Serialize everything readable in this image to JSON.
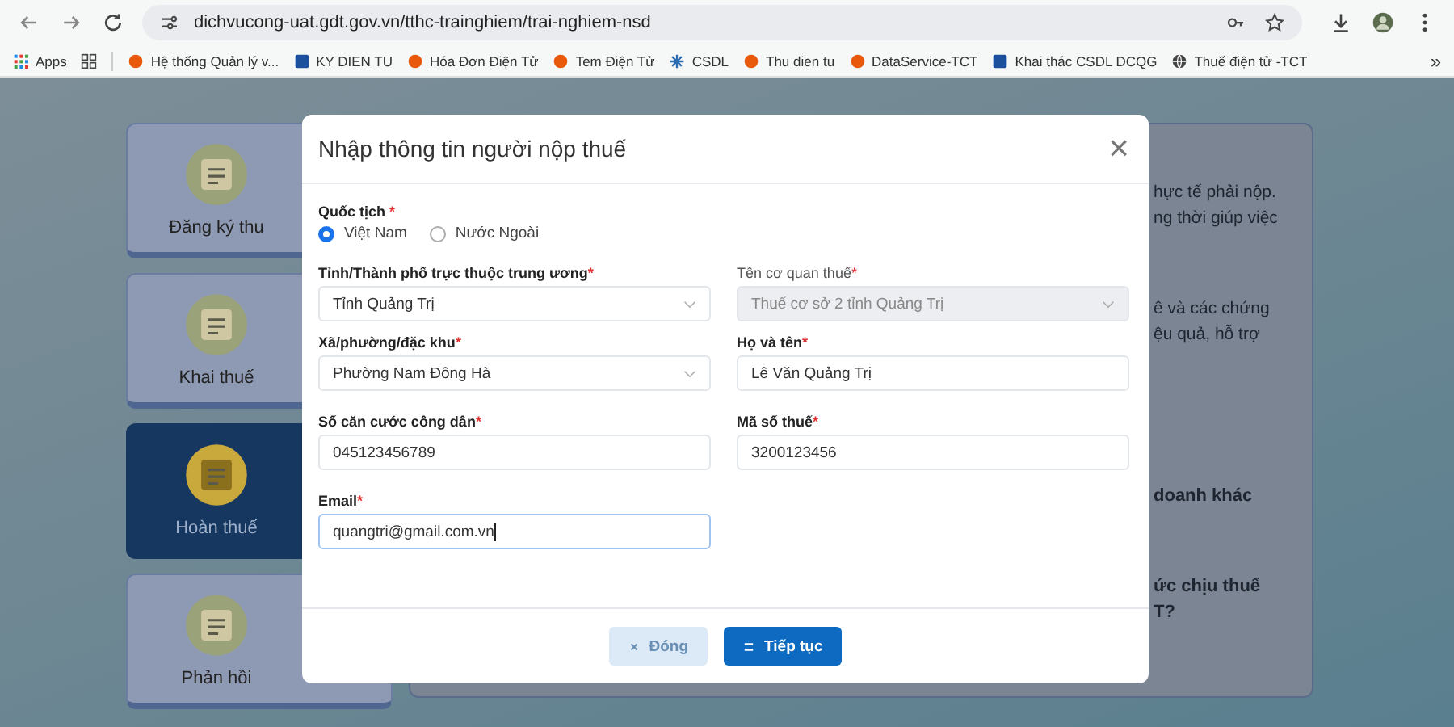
{
  "browser": {
    "url": "dichvucong-uat.gdt.gov.vn/tthc-trainghiem/trai-nghiem-nsd",
    "bookmarks": [
      {
        "label": "Apps",
        "kind": "apps"
      },
      {
        "label": "Hệ thống Quản lý v...",
        "kind": "dot",
        "color": "#e8590c"
      },
      {
        "label": "KY DIEN TU",
        "kind": "square",
        "color": "#1c4f9c"
      },
      {
        "label": "Hóa Đơn Điện Tử",
        "kind": "dot",
        "color": "#e8590c"
      },
      {
        "label": "Tem Điện Tử",
        "kind": "dot",
        "color": "#e8590c"
      },
      {
        "label": "CSDL",
        "kind": "star",
        "color": "#2b6cb0"
      },
      {
        "label": "Thu dien tu",
        "kind": "dot",
        "color": "#e8590c"
      },
      {
        "label": "DataService-TCT",
        "kind": "dot",
        "color": "#e8590c"
      },
      {
        "label": "Khai thác CSDL DCQG",
        "kind": "square",
        "color": "#1c4f9c"
      },
      {
        "label": "Thuế điện tử -TCT",
        "kind": "globe",
        "color": "#444444"
      }
    ],
    "more": "»"
  },
  "services": [
    {
      "label": "Đăng ký thu",
      "selected": false
    },
    {
      "label": "Khai thuế",
      "selected": false
    },
    {
      "label": "Hoàn thuế",
      "selected": true
    },
    {
      "label": "Phản hồi",
      "selected": false
    }
  ],
  "info_panel": {
    "lines": [
      {
        "text": "hực tế phải nộp.",
        "bold": false
      },
      {
        "text": "ng thời giúp việc",
        "bold": false
      },
      {
        "text": "ê và các chứng",
        "bold": false
      },
      {
        "text": "ệu quả, hỗ trợ",
        "bold": false
      },
      {
        "text": "doanh khác",
        "bold": true
      },
      {
        "text": "ức chịu thuế",
        "bold": true
      },
      {
        "text": "T?",
        "bold": true
      }
    ]
  },
  "dialog": {
    "title": "Nhập thông tin người nộp thuế",
    "close": "×",
    "nationality": {
      "label": "Quốc tịch",
      "required_mark": "*",
      "options": [
        {
          "label": "Việt Nam",
          "selected": true
        },
        {
          "label": "Nước Ngoài",
          "selected": false
        }
      ]
    },
    "fields": [
      {
        "label": "Tỉnh/Thành phố trực thuộc trung ương",
        "required": true,
        "kind": "select",
        "value": "Tỉnh Quảng Trị",
        "disabled": false,
        "focused": false
      },
      {
        "label": "Tên cơ quan thuế",
        "required": true,
        "kind": "select",
        "value": "Thuế cơ sở 2 tỉnh Quảng Trị",
        "disabled": true,
        "focused": false
      },
      {
        "label": "Xã/phường/đặc khu",
        "required": true,
        "kind": "select",
        "value": "Phường Nam Đông Hà",
        "disabled": false,
        "focused": false
      },
      {
        "label": "Họ và tên",
        "required": true,
        "kind": "text",
        "value": "Lê Văn Quảng Trị",
        "disabled": false,
        "focused": false
      },
      {
        "label": "Số căn cước công dân",
        "required": true,
        "kind": "text",
        "value": "045123456789",
        "disabled": false,
        "focused": false
      },
      {
        "label": "Mã số thuế",
        "required": true,
        "kind": "text",
        "value": "3200123456",
        "disabled": false,
        "focused": false
      },
      {
        "label": "Email",
        "required": true,
        "kind": "text",
        "value": "quangtri@gmail.com.vn",
        "disabled": false,
        "focused": true
      }
    ],
    "buttons": [
      {
        "label": "Đóng",
        "kind": "secondary"
      },
      {
        "label": "Tiếp tục",
        "kind": "primary"
      }
    ]
  }
}
